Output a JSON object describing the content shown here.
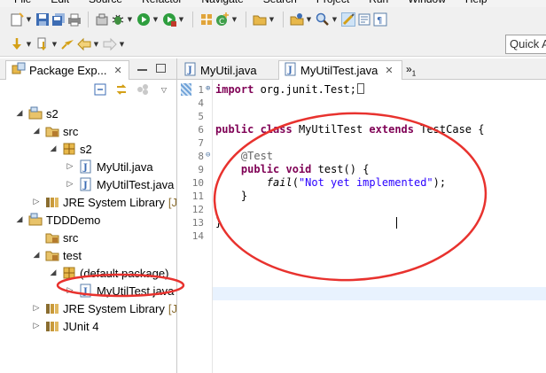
{
  "menu": [
    "File",
    "Edit",
    "Source",
    "Refactor",
    "Navigate",
    "Search",
    "Project",
    "Run",
    "Window",
    "Help"
  ],
  "quick_access": {
    "placeholder": "Quick A"
  },
  "package_explorer": {
    "tab_label": "Package Exp...",
    "tree": [
      {
        "indent": 0,
        "twisty": "open",
        "icon": "project-icon",
        "label": "s2"
      },
      {
        "indent": 1,
        "twisty": "open",
        "icon": "source-folder-icon",
        "label": "src"
      },
      {
        "indent": 2,
        "twisty": "open",
        "icon": "package-icon",
        "label": "s2"
      },
      {
        "indent": 3,
        "twisty": "closed",
        "icon": "java-file-icon",
        "label": "MyUtil.java"
      },
      {
        "indent": 3,
        "twisty": "closed",
        "icon": "java-file-icon",
        "label": "MyUtilTest.java"
      },
      {
        "indent": 1,
        "twisty": "closed",
        "icon": "library-icon",
        "label": "JRE System Library",
        "suffix": "[J"
      },
      {
        "indent": 0,
        "twisty": "open",
        "icon": "project-icon",
        "label": "TDDDemo"
      },
      {
        "indent": 1,
        "twisty": "none",
        "icon": "source-folder-icon",
        "label": "src"
      },
      {
        "indent": 1,
        "twisty": "open",
        "icon": "source-folder-icon",
        "label": "test"
      },
      {
        "indent": 2,
        "twisty": "open",
        "icon": "package-icon",
        "label": "(default package)"
      },
      {
        "indent": 3,
        "twisty": "closed",
        "icon": "java-file-icon",
        "label": "MyUtilTest.java"
      },
      {
        "indent": 1,
        "twisty": "closed",
        "icon": "library-icon",
        "label": "JRE System Library",
        "suffix": "[J"
      },
      {
        "indent": 1,
        "twisty": "closed",
        "icon": "library-icon",
        "label": "JUnit 4"
      }
    ]
  },
  "editor": {
    "tabs": [
      {
        "label": "MyUtil.java",
        "active": false
      },
      {
        "label": "MyUtilTest.java",
        "active": true
      }
    ],
    "more_tabs": {
      "label": "»",
      "count": "1"
    },
    "lines": [
      {
        "num": "1",
        "fold": "⊕"
      },
      {
        "num": "4",
        "fold": ""
      },
      {
        "num": "5",
        "fold": ""
      },
      {
        "num": "6",
        "fold": ""
      },
      {
        "num": "7",
        "fold": ""
      },
      {
        "num": "8",
        "fold": "⊖"
      },
      {
        "num": "9",
        "fold": ""
      },
      {
        "num": "10",
        "fold": ""
      },
      {
        "num": "11",
        "fold": ""
      },
      {
        "num": "12",
        "fold": ""
      },
      {
        "num": "13",
        "fold": ""
      },
      {
        "num": "14",
        "fold": ""
      }
    ],
    "code": {
      "l1_kw": "import",
      "l1_rest": " org.junit.Test;",
      "l6_kw1": "public",
      "l6_kw2": "class",
      "l6_name": " MyUtilTest ",
      "l6_kw3": "extends",
      "l6_rest": " TestCase {",
      "l8_ann": "@Test",
      "l9_kw1": "public",
      "l9_kw2": "void",
      "l9_rest": " test() {",
      "l10_method": "fail",
      "l10_open": "(",
      "l10_str": "\"Not yet implemented\"",
      "l10_close": ");",
      "l11": "}",
      "l13": "}"
    }
  },
  "colors": {
    "keyword": "#7f0055",
    "string": "#2a00ff",
    "annotation": "#646464",
    "annotation_ellipse": "#e8322e",
    "current_line": "#e8f2fe"
  }
}
